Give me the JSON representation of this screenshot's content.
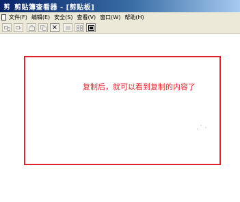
{
  "window": {
    "app_icon": "剪",
    "title": "剪贴簿查看器 - [剪贴板]"
  },
  "menu": {
    "items": [
      {
        "label": "文件(F)"
      },
      {
        "label": "编辑(E)"
      },
      {
        "label": "安全(S)"
      },
      {
        "label": "查看(V)"
      },
      {
        "label": "窗口(W)"
      },
      {
        "label": "帮助(H)"
      }
    ]
  },
  "toolbar": {
    "buttons": [
      "connect",
      "disconnect",
      "share",
      "copy",
      "delete",
      "table-view",
      "thumbnail-view",
      "full-page-view"
    ],
    "delete_glyph": "✕"
  },
  "content": {
    "annotation": "复制后，就可以看到复制的内容了",
    "annotation_color": "#e0202a"
  }
}
